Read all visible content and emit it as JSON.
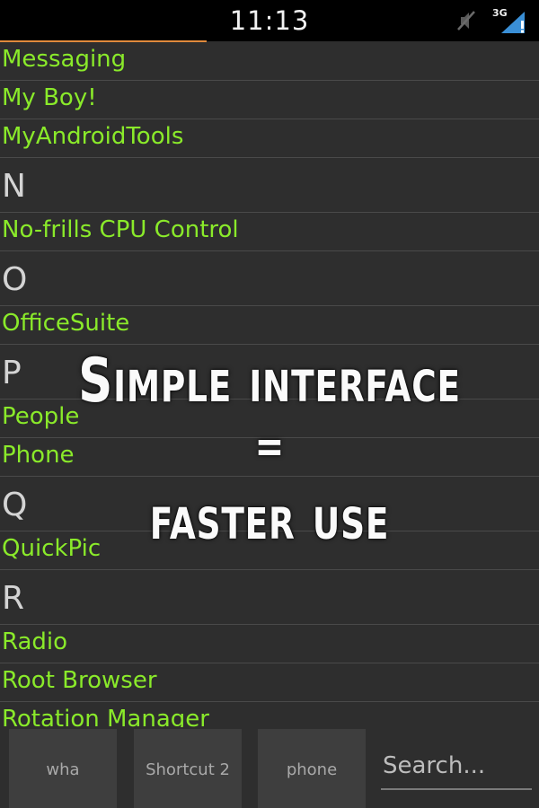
{
  "status_bar": {
    "time": "11:13",
    "network_type": "3G",
    "icons": [
      "mute-icon",
      "signal-icon"
    ]
  },
  "list": {
    "rows": [
      {
        "type": "app",
        "label": "Messaging"
      },
      {
        "type": "app",
        "label": "My Boy!"
      },
      {
        "type": "app",
        "label": "MyAndroidTools"
      },
      {
        "type": "header",
        "label": "N"
      },
      {
        "type": "app",
        "label": "No-frills CPU Control"
      },
      {
        "type": "header",
        "label": "O"
      },
      {
        "type": "app",
        "label": "OfficeSuite"
      },
      {
        "type": "header",
        "label": "P"
      },
      {
        "type": "app",
        "label": "People"
      },
      {
        "type": "app",
        "label": "Phone"
      },
      {
        "type": "header",
        "label": "Q"
      },
      {
        "type": "app",
        "label": "QuickPic"
      },
      {
        "type": "header",
        "label": "R"
      },
      {
        "type": "app",
        "label": "Radio"
      },
      {
        "type": "app",
        "label": "Root Browser"
      },
      {
        "type": "app",
        "label": "Rotation Manager"
      }
    ]
  },
  "promo": {
    "line1": "Simple interface",
    "equals": "=",
    "line2": "faster use"
  },
  "bottom_bar": {
    "shortcuts": [
      "wha",
      "Shortcut 2",
      "phone"
    ],
    "search_placeholder": "Search..."
  },
  "colors": {
    "app_label": "#8aea2a",
    "header_label": "#d4d4d4",
    "background": "#2e2e2e",
    "scroll_accent": "#e08a3c"
  }
}
